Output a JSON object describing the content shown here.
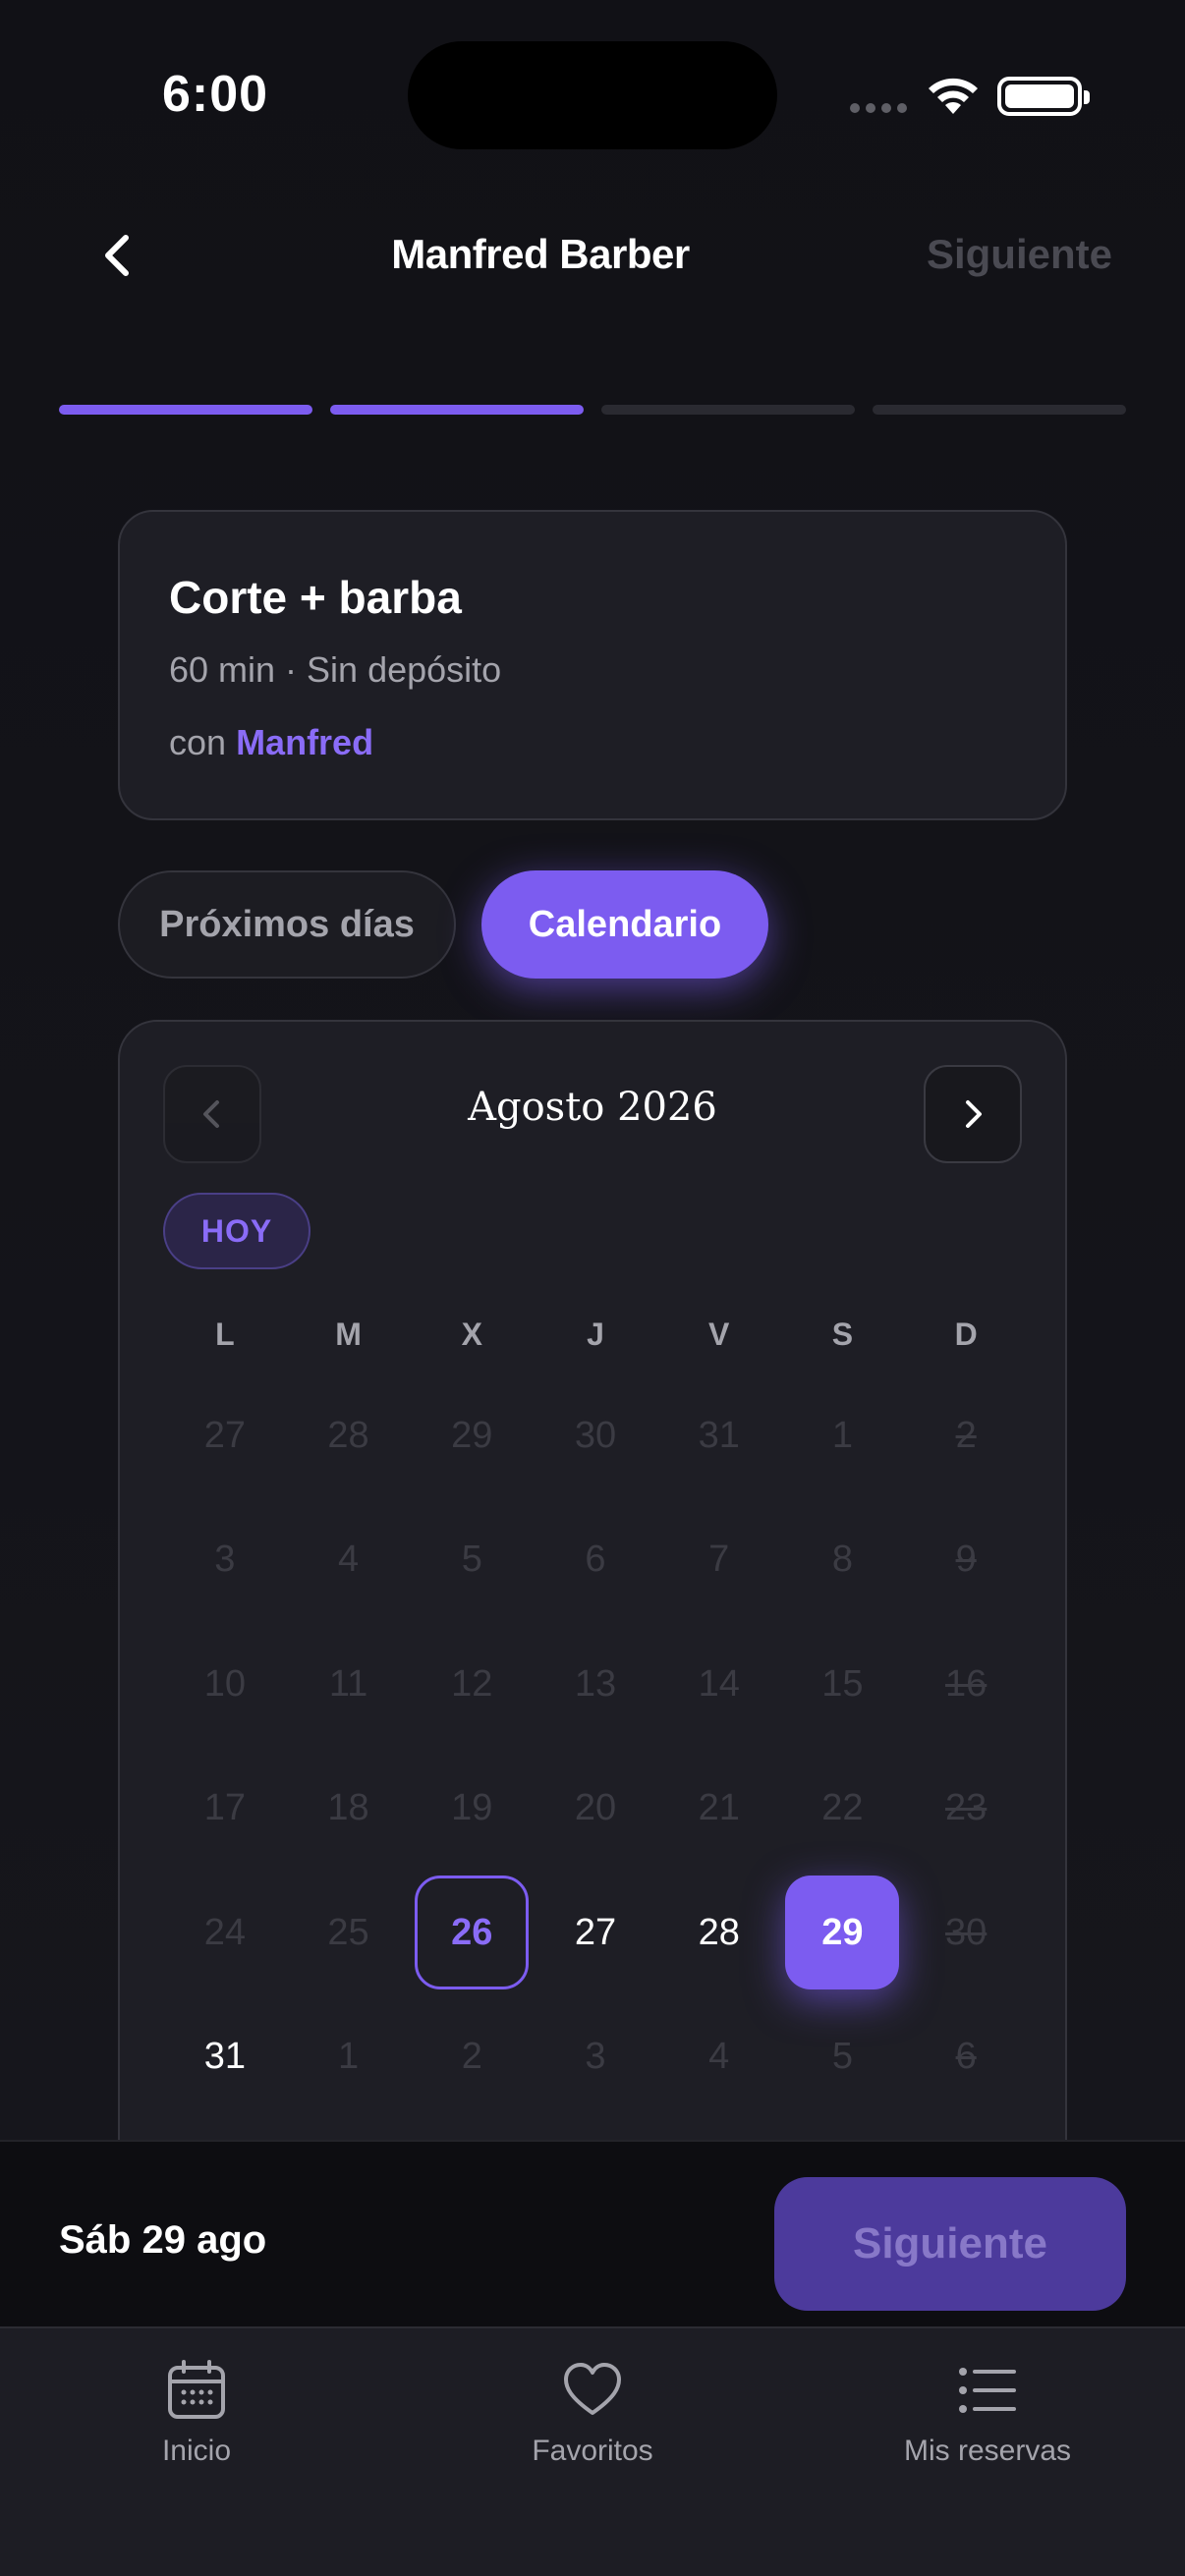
{
  "status_bar": {
    "time": "6:00"
  },
  "header": {
    "title": "Manfred Barber",
    "next_label": "Siguiente"
  },
  "progress": {
    "total_steps": 4,
    "completed_steps": 2
  },
  "service": {
    "name": "Corte + barba",
    "meta": "60 min · Sin depósito",
    "with_prefix": "con",
    "barber": "Manfred"
  },
  "view_toggle": {
    "upcoming_label": "Próximos días",
    "calendar_label": "Calendario",
    "active": "Calendario"
  },
  "calendar": {
    "month_label": "Agosto 2026",
    "today_badge": "HOY",
    "weekdays": [
      "L",
      "M",
      "X",
      "J",
      "V",
      "S",
      "D"
    ],
    "days": [
      {
        "n": "27",
        "state": "other"
      },
      {
        "n": "28",
        "state": "other"
      },
      {
        "n": "29",
        "state": "other"
      },
      {
        "n": "30",
        "state": "other"
      },
      {
        "n": "31",
        "state": "other"
      },
      {
        "n": "1",
        "state": "past"
      },
      {
        "n": "2",
        "state": "closed"
      },
      {
        "n": "3",
        "state": "past"
      },
      {
        "n": "4",
        "state": "past"
      },
      {
        "n": "5",
        "state": "past"
      },
      {
        "n": "6",
        "state": "past"
      },
      {
        "n": "7",
        "state": "past"
      },
      {
        "n": "8",
        "state": "past"
      },
      {
        "n": "9",
        "state": "closed"
      },
      {
        "n": "10",
        "state": "past"
      },
      {
        "n": "11",
        "state": "past"
      },
      {
        "n": "12",
        "state": "past"
      },
      {
        "n": "13",
        "state": "past"
      },
      {
        "n": "14",
        "state": "past"
      },
      {
        "n": "15",
        "state": "past"
      },
      {
        "n": "16",
        "state": "closed"
      },
      {
        "n": "17",
        "state": "past"
      },
      {
        "n": "18",
        "state": "past"
      },
      {
        "n": "19",
        "state": "past"
      },
      {
        "n": "20",
        "state": "past"
      },
      {
        "n": "21",
        "state": "past"
      },
      {
        "n": "22",
        "state": "past"
      },
      {
        "n": "23",
        "state": "closed"
      },
      {
        "n": "24",
        "state": "past"
      },
      {
        "n": "25",
        "state": "past"
      },
      {
        "n": "26",
        "state": "today"
      },
      {
        "n": "27",
        "state": "available"
      },
      {
        "n": "28",
        "state": "available"
      },
      {
        "n": "29",
        "state": "selected"
      },
      {
        "n": "30",
        "state": "closed"
      },
      {
        "n": "31",
        "state": "available"
      },
      {
        "n": "1",
        "state": "other"
      },
      {
        "n": "2",
        "state": "other"
      },
      {
        "n": "3",
        "state": "other"
      },
      {
        "n": "4",
        "state": "other"
      },
      {
        "n": "5",
        "state": "other"
      },
      {
        "n": "6",
        "state": "other-closed"
      }
    ]
  },
  "action_bar": {
    "selected_date": "Sáb 29 ago",
    "next_label": "Siguiente"
  },
  "tabbar": {
    "items": [
      {
        "label": "Inicio",
        "icon": "calendar-icon"
      },
      {
        "label": "Favoritos",
        "icon": "heart-icon"
      },
      {
        "label": "Mis reservas",
        "icon": "list-icon"
      }
    ]
  },
  "colors": {
    "accent": "#7c5cf0",
    "background": "#141419",
    "card": "#1e1e25"
  }
}
